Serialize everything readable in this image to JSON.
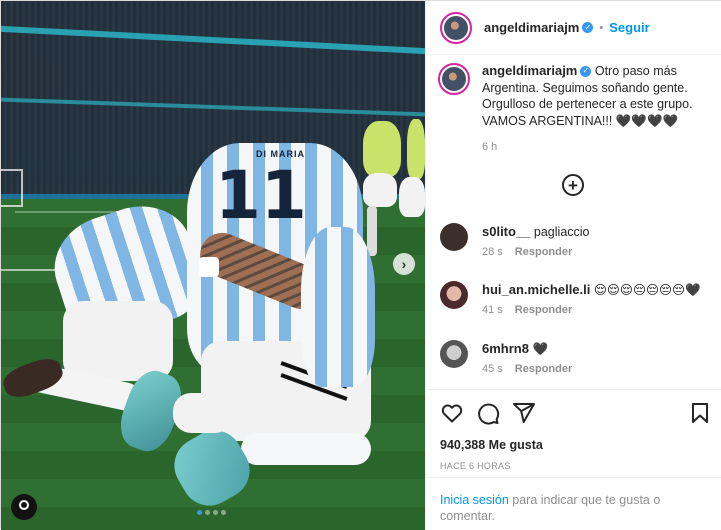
{
  "post": {
    "author": "angeldimariajm",
    "verified": true,
    "follow_label": "Seguir",
    "separator": "•",
    "caption": "Otro paso más Argentina. Seguimos soñando gente. Orgulloso de pertenecer a este grupo. VAMOS ARGENTINA!!! 🖤🖤🖤🖤",
    "time": "6 h",
    "likes": "940,388 Me gusta",
    "posted_ago": "HACE 6 HORAS"
  },
  "photo": {
    "jersey_number": "11",
    "jersey_name": "DI MARIA",
    "carousel_total": 4,
    "carousel_active": 0
  },
  "comments": [
    {
      "user": "s0lito__",
      "text": "pagliaccio",
      "time": "28 s",
      "reply": "Responder",
      "avatar_color": "#3a2f2a"
    },
    {
      "user": "hui_an.michelle.li",
      "text": "😌😌😌😔😔😔😔🖤",
      "time": "41 s",
      "reply": "Responder",
      "avatar_color": "#c18d8a"
    },
    {
      "user": "6mhrn8",
      "text": "🖤",
      "time": "45 s",
      "reply": "Responder",
      "avatar_color": "#6b6b6b"
    }
  ],
  "footer": {
    "login_link": "Inicia sesión",
    "login_text": "para indicar que te gusta o comentar."
  },
  "icons": [
    "heart-icon",
    "comment-icon",
    "share-icon",
    "bookmark-icon",
    "plus-circle-icon",
    "chevron-right-icon",
    "user-tag-icon"
  ],
  "colors": {
    "accent": "#0095f6",
    "verified": "#3897f0",
    "text": "#262626",
    "muted": "#8e8e8e"
  }
}
